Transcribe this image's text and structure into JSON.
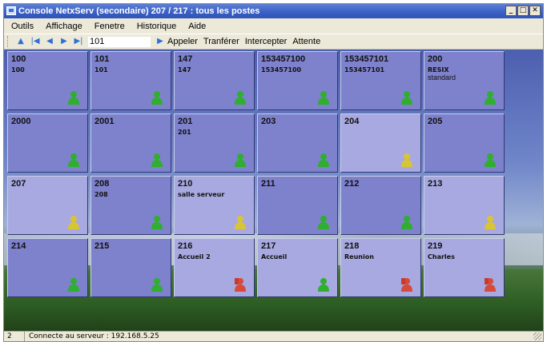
{
  "window": {
    "title": "Console NetxServ (secondaire) 207 / 217 : tous les postes",
    "controls": [
      "minimize-icon",
      "maximize-icon",
      "close-icon"
    ]
  },
  "menu": {
    "outils": "Outils",
    "affichage": "Affichage",
    "fenetre": "Fenetre",
    "historique": "Historique",
    "aide": "Aide"
  },
  "toolbar": {
    "number_value": "101",
    "appeler": "Appeler",
    "transferer": "Tranférer",
    "intercepter": "Intercepter",
    "attente": "Attente",
    "icons": [
      "up-arrow-icon",
      "first-icon",
      "prev-icon",
      "next-icon",
      "last-icon",
      "go-icon"
    ]
  },
  "tiles": [
    {
      "number": "100",
      "label": "100",
      "sub": "",
      "status": "available",
      "shade": "dark"
    },
    {
      "number": "101",
      "label": "101",
      "sub": "",
      "status": "available",
      "shade": "dark"
    },
    {
      "number": "147",
      "label": "147",
      "sub": "",
      "status": "available",
      "shade": "dark"
    },
    {
      "number": "153457100",
      "label": "153457100",
      "sub": "",
      "status": "available",
      "shade": "dark"
    },
    {
      "number": "153457101",
      "label": "153457101",
      "sub": "",
      "status": "available",
      "shade": "dark"
    },
    {
      "number": "200",
      "label": "RESIX",
      "sub": "standard",
      "status": "available",
      "shade": "dark"
    },
    {
      "number": "2000",
      "label": "",
      "sub": "",
      "status": "available",
      "shade": "dark"
    },
    {
      "number": "2001",
      "label": "",
      "sub": "",
      "status": "available",
      "shade": "dark"
    },
    {
      "number": "201",
      "label": "201",
      "sub": "",
      "status": "available",
      "shade": "dark"
    },
    {
      "number": "203",
      "label": "",
      "sub": "",
      "status": "available",
      "shade": "dark"
    },
    {
      "number": "204",
      "label": "",
      "sub": "",
      "status": "away",
      "shade": "light"
    },
    {
      "number": "205",
      "label": "",
      "sub": "",
      "status": "available",
      "shade": "dark"
    },
    {
      "number": "207",
      "label": "",
      "sub": "",
      "status": "away",
      "shade": "light"
    },
    {
      "number": "208",
      "label": "208",
      "sub": "",
      "status": "available",
      "shade": "dark"
    },
    {
      "number": "210",
      "label": "salle serveur",
      "sub": "",
      "status": "away",
      "shade": "light"
    },
    {
      "number": "211",
      "label": "",
      "sub": "",
      "status": "available",
      "shade": "dark"
    },
    {
      "number": "212",
      "label": "",
      "sub": "",
      "status": "available",
      "shade": "dark"
    },
    {
      "number": "213",
      "label": "",
      "sub": "",
      "status": "away",
      "shade": "light"
    },
    {
      "number": "214",
      "label": "",
      "sub": "",
      "status": "available",
      "shade": "dark"
    },
    {
      "number": "215",
      "label": "",
      "sub": "",
      "status": "available",
      "shade": "dark"
    },
    {
      "number": "216",
      "label": "Accueil 2",
      "sub": "",
      "status": "busy",
      "shade": "light"
    },
    {
      "number": "217",
      "label": "Accueil",
      "sub": "",
      "status": "available",
      "shade": "light"
    },
    {
      "number": "218",
      "label": "Reunion",
      "sub": "",
      "status": "busy",
      "shade": "light"
    },
    {
      "number": "219",
      "label": "Charles",
      "sub": "",
      "status": "busy",
      "shade": "light"
    }
  ],
  "status_colors": {
    "available": "#2fae2f",
    "away": "#d7c534",
    "busy": "#d64a3a"
  },
  "statusbar": {
    "count": "2",
    "text": "Connecte au serveur : 192.168.5.25"
  }
}
